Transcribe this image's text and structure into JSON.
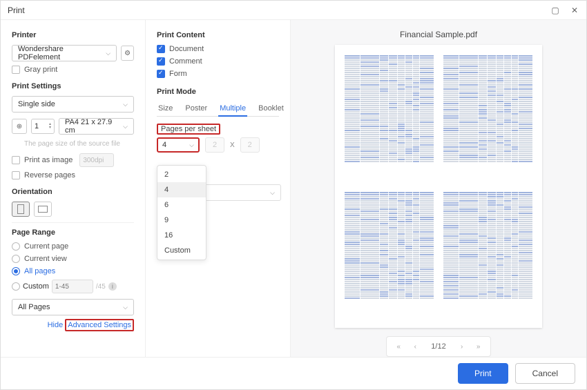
{
  "window": {
    "title": "Print"
  },
  "left": {
    "printer_heading": "Printer",
    "printer_selected": "Wondershare PDFelement",
    "gray_print": "Gray print",
    "print_settings_heading": "Print Settings",
    "sides_selected": "Single side",
    "copies_value": "1",
    "paper_selected": "PA4 21 x 27.9 cm",
    "source_file_note": "The page size of the source file",
    "print_as_image": "Print as image",
    "dpi_placeholder": "300dpi",
    "reverse_pages": "Reverse pages",
    "orientation_heading": "Orientation",
    "page_range_heading": "Page Range",
    "current_page": "Current page",
    "current_view": "Current view",
    "all_pages": "All pages",
    "custom": "Custom",
    "custom_placeholder": "1-45",
    "custom_total": "/45",
    "subset_selected": "All Pages",
    "hide_text": "Hide",
    "adv_text": "Advanced Settings"
  },
  "mid": {
    "print_content_heading": "Print Content",
    "document": "Document",
    "comment": "Comment",
    "form": "Form",
    "print_mode_heading": "Print Mode",
    "tabs": {
      "size": "Size",
      "poster": "Poster",
      "multiple": "Multiple",
      "booklet": "Booklet"
    },
    "pages_per_sheet_label": "Pages per sheet",
    "pps_selected": "4",
    "pps_x": "2",
    "pps_y": "2",
    "x_sep": "X",
    "options": {
      "o2": "2",
      "o4": "4",
      "o6": "6",
      "o9": "9",
      "o16": "16",
      "custom": "Custom"
    }
  },
  "right": {
    "filename": "Financial Sample.pdf",
    "page_current": "1",
    "page_total": "/12"
  },
  "footer": {
    "print": "Print",
    "cancel": "Cancel"
  }
}
